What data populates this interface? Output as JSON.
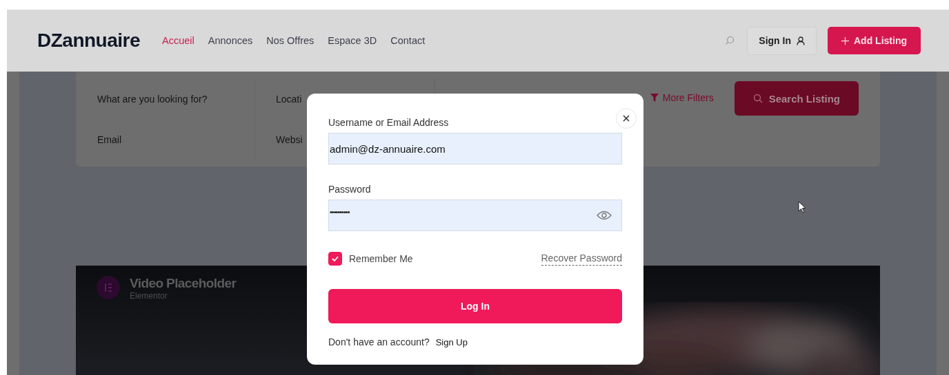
{
  "header": {
    "logo": "DZannuaire",
    "nav": [
      {
        "label": "Accueil",
        "selected": true
      },
      {
        "label": "Annonces",
        "selected": false
      },
      {
        "label": "Nos Offres",
        "selected": false
      },
      {
        "label": "Espace 3D",
        "selected": false
      },
      {
        "label": "Contact",
        "selected": false
      }
    ],
    "sign_in": "Sign In",
    "add_listing": "Add Listing"
  },
  "search_form": {
    "fields": [
      {
        "label": "What are you looking for?"
      },
      {
        "label": "Locati"
      },
      {
        "label": "Email"
      },
      {
        "label": "Websi"
      }
    ],
    "more_filters": "More Filters",
    "search_button": "Search Listing"
  },
  "video": {
    "kind": "picture",
    "title": "Video Placeholder",
    "subtitle": "Elementor"
  },
  "login_modal": {
    "username_label": "Username or Email Address",
    "username_value": "admin@dz-annuaire.com",
    "password_label": "Password",
    "password_value": "••••••••••",
    "remember_me": {
      "label": "Remember Me",
      "checked": true
    },
    "recover_password": "Recover Password",
    "login_button": "Log In",
    "no_account": "Don't have an account?",
    "sign_up": "Sign Up"
  }
}
